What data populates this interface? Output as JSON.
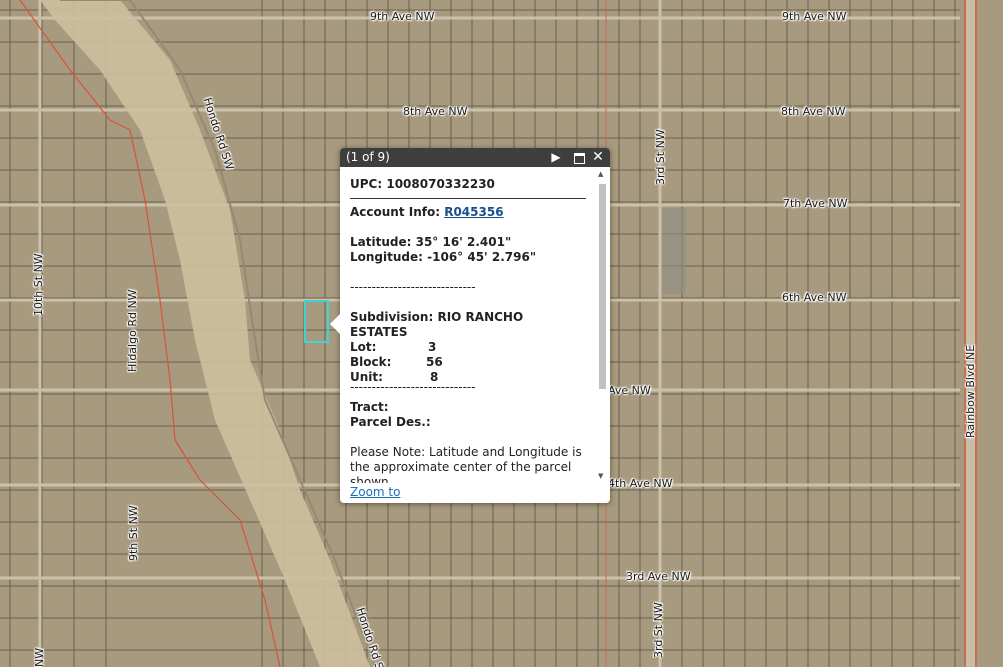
{
  "map": {
    "street_labels": [
      {
        "id": "label-9th-ave-nw-1",
        "text": "9th Ave NW"
      },
      {
        "id": "label-9th-ave-nw-2",
        "text": "9th Ave NW"
      },
      {
        "id": "label-8th-ave-nw-1",
        "text": "8th Ave NW"
      },
      {
        "id": "label-8th-ave-nw-2",
        "text": "8th Ave NW"
      },
      {
        "id": "label-7th-ave-nw",
        "text": "7th Ave NW"
      },
      {
        "id": "label-6th-ave-nw",
        "text": "6th Ave NW"
      },
      {
        "id": "label-5th-ave-nw",
        "text": "Ave NW"
      },
      {
        "id": "label-4th-ave-nw",
        "text": "4th Ave NW"
      },
      {
        "id": "label-3rd-ave-nw",
        "text": "3rd Ave NW"
      },
      {
        "id": "label-hondo-rd-sw-1",
        "text": "Hondo Rd SW"
      },
      {
        "id": "label-hondo-rd-sw-2",
        "text": "Hondo Rd S"
      },
      {
        "id": "label-10th-st-nw",
        "text": "10th St NW"
      },
      {
        "id": "label-hidalgo-rd-nw",
        "text": "Hidalgo Rd NW"
      },
      {
        "id": "label-9th-st-nw",
        "text": "9th St NW"
      },
      {
        "id": "label-3rd-st-nw-1",
        "text": "3rd St NW"
      },
      {
        "id": "label-3rd-st-nw-2",
        "text": "3rd St NW"
      },
      {
        "id": "label-rainbow-blvd-ne",
        "text": "Rainbow Blvd NE"
      },
      {
        "id": "label-nw-bottom",
        "text": "NW"
      }
    ],
    "colors": {
      "ground": "#a89a7e",
      "parcel_line": "#5f5747",
      "road": "#c9bfa9",
      "arroyo": "#cdbf9f",
      "highlight": "#3fd3d3",
      "red_line": "#d9533a"
    }
  },
  "popup": {
    "title": "(1 of 9)",
    "icons": {
      "next": "play-next-icon",
      "maximize": "maximize-icon",
      "close": "close-icon"
    },
    "upc_label": "UPC:",
    "upc_value": "1008070332230",
    "account_label": "Account Info:",
    "account_value": "R045356",
    "latitude_label": "Latitude:",
    "latitude_value": "35° 16' 2.401\"",
    "longitude_label": "Longitude:",
    "longitude_value": "-106° 45' 2.796\"",
    "dashes": "-----------------------------",
    "subdivision_label": "Subdivision:",
    "subdivision_value": "RIO RANCHO",
    "subdivision_value_2": "ESTATES",
    "lot_label": "Lot:",
    "lot_value": "3",
    "block_label": "Block:",
    "block_value": "56",
    "unit_label": "Unit:",
    "unit_value": "8",
    "tract_label": "Tract:",
    "parcel_des_label": "Parcel Des.:",
    "note_line1": "Please Note: Latitude and Longitude is",
    "note_line2": "the approximate center of the parcel",
    "note_line3": "shown",
    "zoom_to": "Zoom to"
  }
}
